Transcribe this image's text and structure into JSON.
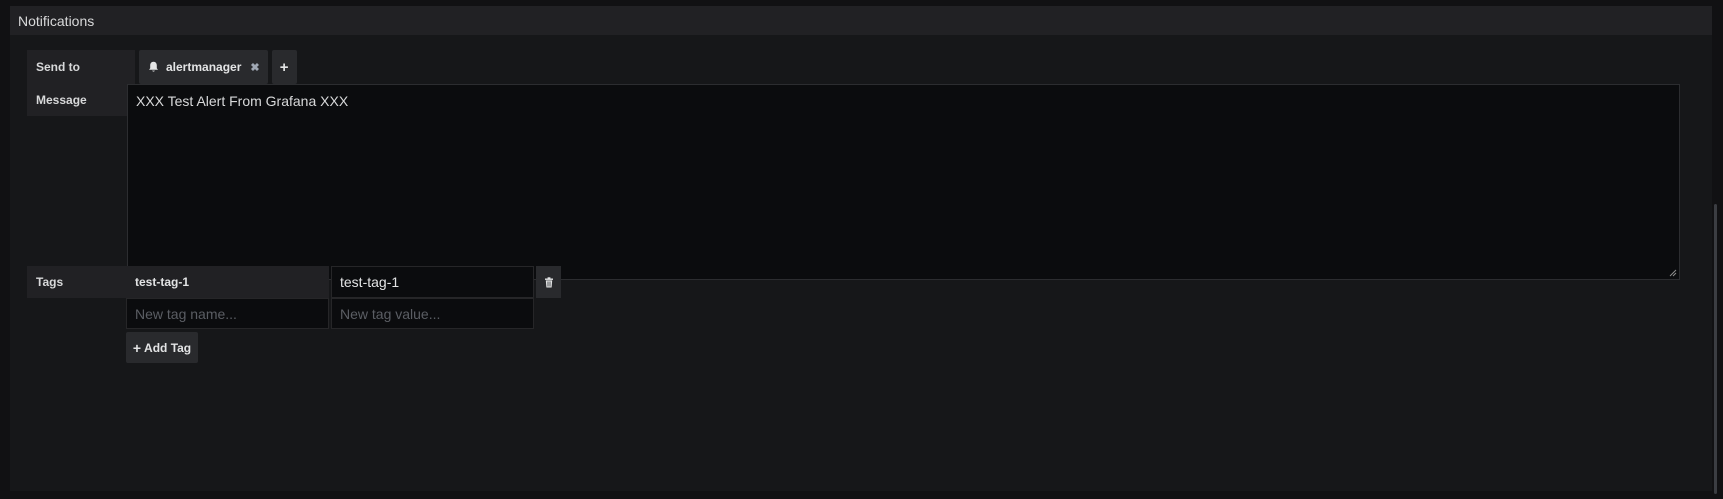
{
  "panel": {
    "title": "Notifications"
  },
  "send_to": {
    "label": "Send to",
    "channels": [
      {
        "name": "alertmanager",
        "icon": "bell-icon"
      }
    ],
    "remove_glyph": "✖",
    "add_glyph": "+"
  },
  "message": {
    "label": "Message",
    "value": "XXX Test Alert From Grafana XXX"
  },
  "tags": {
    "label": "Tags",
    "items": [
      {
        "name": "test-tag-1",
        "value": "test-tag-1"
      }
    ],
    "new_name_placeholder": "New tag name...",
    "new_value_placeholder": "New tag value...",
    "add_label": "Add Tag",
    "add_glyph": "+"
  },
  "colors": {
    "background": "#111113",
    "panel": "#161719",
    "header": "#212124",
    "input": "#0b0c0e",
    "button": "#292a2d",
    "text": "#d8d9da"
  }
}
